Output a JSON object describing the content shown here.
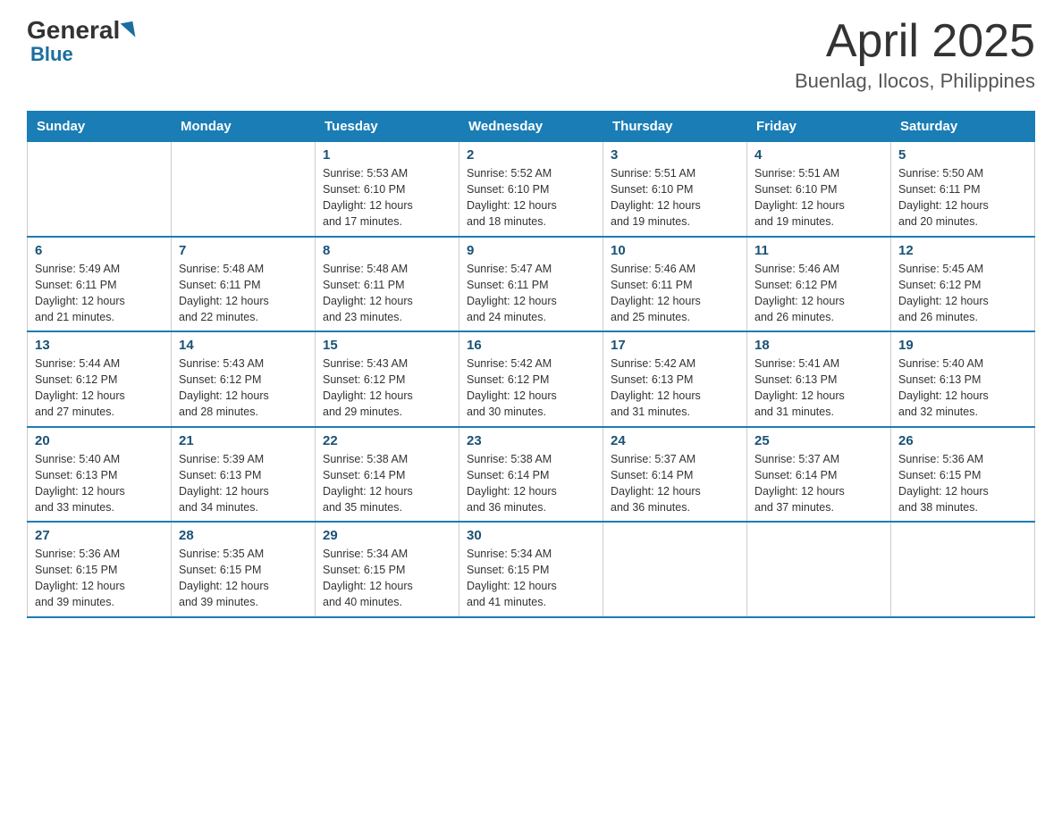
{
  "header": {
    "logo_general": "General",
    "logo_blue": "Blue",
    "month_title": "April 2025",
    "location": "Buenlag, Ilocos, Philippines"
  },
  "days_of_week": [
    "Sunday",
    "Monday",
    "Tuesday",
    "Wednesday",
    "Thursday",
    "Friday",
    "Saturday"
  ],
  "weeks": [
    [
      {
        "day": "",
        "info": ""
      },
      {
        "day": "",
        "info": ""
      },
      {
        "day": "1",
        "info": "Sunrise: 5:53 AM\nSunset: 6:10 PM\nDaylight: 12 hours\nand 17 minutes."
      },
      {
        "day": "2",
        "info": "Sunrise: 5:52 AM\nSunset: 6:10 PM\nDaylight: 12 hours\nand 18 minutes."
      },
      {
        "day": "3",
        "info": "Sunrise: 5:51 AM\nSunset: 6:10 PM\nDaylight: 12 hours\nand 19 minutes."
      },
      {
        "day": "4",
        "info": "Sunrise: 5:51 AM\nSunset: 6:10 PM\nDaylight: 12 hours\nand 19 minutes."
      },
      {
        "day": "5",
        "info": "Sunrise: 5:50 AM\nSunset: 6:11 PM\nDaylight: 12 hours\nand 20 minutes."
      }
    ],
    [
      {
        "day": "6",
        "info": "Sunrise: 5:49 AM\nSunset: 6:11 PM\nDaylight: 12 hours\nand 21 minutes."
      },
      {
        "day": "7",
        "info": "Sunrise: 5:48 AM\nSunset: 6:11 PM\nDaylight: 12 hours\nand 22 minutes."
      },
      {
        "day": "8",
        "info": "Sunrise: 5:48 AM\nSunset: 6:11 PM\nDaylight: 12 hours\nand 23 minutes."
      },
      {
        "day": "9",
        "info": "Sunrise: 5:47 AM\nSunset: 6:11 PM\nDaylight: 12 hours\nand 24 minutes."
      },
      {
        "day": "10",
        "info": "Sunrise: 5:46 AM\nSunset: 6:11 PM\nDaylight: 12 hours\nand 25 minutes."
      },
      {
        "day": "11",
        "info": "Sunrise: 5:46 AM\nSunset: 6:12 PM\nDaylight: 12 hours\nand 26 minutes."
      },
      {
        "day": "12",
        "info": "Sunrise: 5:45 AM\nSunset: 6:12 PM\nDaylight: 12 hours\nand 26 minutes."
      }
    ],
    [
      {
        "day": "13",
        "info": "Sunrise: 5:44 AM\nSunset: 6:12 PM\nDaylight: 12 hours\nand 27 minutes."
      },
      {
        "day": "14",
        "info": "Sunrise: 5:43 AM\nSunset: 6:12 PM\nDaylight: 12 hours\nand 28 minutes."
      },
      {
        "day": "15",
        "info": "Sunrise: 5:43 AM\nSunset: 6:12 PM\nDaylight: 12 hours\nand 29 minutes."
      },
      {
        "day": "16",
        "info": "Sunrise: 5:42 AM\nSunset: 6:12 PM\nDaylight: 12 hours\nand 30 minutes."
      },
      {
        "day": "17",
        "info": "Sunrise: 5:42 AM\nSunset: 6:13 PM\nDaylight: 12 hours\nand 31 minutes."
      },
      {
        "day": "18",
        "info": "Sunrise: 5:41 AM\nSunset: 6:13 PM\nDaylight: 12 hours\nand 31 minutes."
      },
      {
        "day": "19",
        "info": "Sunrise: 5:40 AM\nSunset: 6:13 PM\nDaylight: 12 hours\nand 32 minutes."
      }
    ],
    [
      {
        "day": "20",
        "info": "Sunrise: 5:40 AM\nSunset: 6:13 PM\nDaylight: 12 hours\nand 33 minutes."
      },
      {
        "day": "21",
        "info": "Sunrise: 5:39 AM\nSunset: 6:13 PM\nDaylight: 12 hours\nand 34 minutes."
      },
      {
        "day": "22",
        "info": "Sunrise: 5:38 AM\nSunset: 6:14 PM\nDaylight: 12 hours\nand 35 minutes."
      },
      {
        "day": "23",
        "info": "Sunrise: 5:38 AM\nSunset: 6:14 PM\nDaylight: 12 hours\nand 36 minutes."
      },
      {
        "day": "24",
        "info": "Sunrise: 5:37 AM\nSunset: 6:14 PM\nDaylight: 12 hours\nand 36 minutes."
      },
      {
        "day": "25",
        "info": "Sunrise: 5:37 AM\nSunset: 6:14 PM\nDaylight: 12 hours\nand 37 minutes."
      },
      {
        "day": "26",
        "info": "Sunrise: 5:36 AM\nSunset: 6:15 PM\nDaylight: 12 hours\nand 38 minutes."
      }
    ],
    [
      {
        "day": "27",
        "info": "Sunrise: 5:36 AM\nSunset: 6:15 PM\nDaylight: 12 hours\nand 39 minutes."
      },
      {
        "day": "28",
        "info": "Sunrise: 5:35 AM\nSunset: 6:15 PM\nDaylight: 12 hours\nand 39 minutes."
      },
      {
        "day": "29",
        "info": "Sunrise: 5:34 AM\nSunset: 6:15 PM\nDaylight: 12 hours\nand 40 minutes."
      },
      {
        "day": "30",
        "info": "Sunrise: 5:34 AM\nSunset: 6:15 PM\nDaylight: 12 hours\nand 41 minutes."
      },
      {
        "day": "",
        "info": ""
      },
      {
        "day": "",
        "info": ""
      },
      {
        "day": "",
        "info": ""
      }
    ]
  ]
}
